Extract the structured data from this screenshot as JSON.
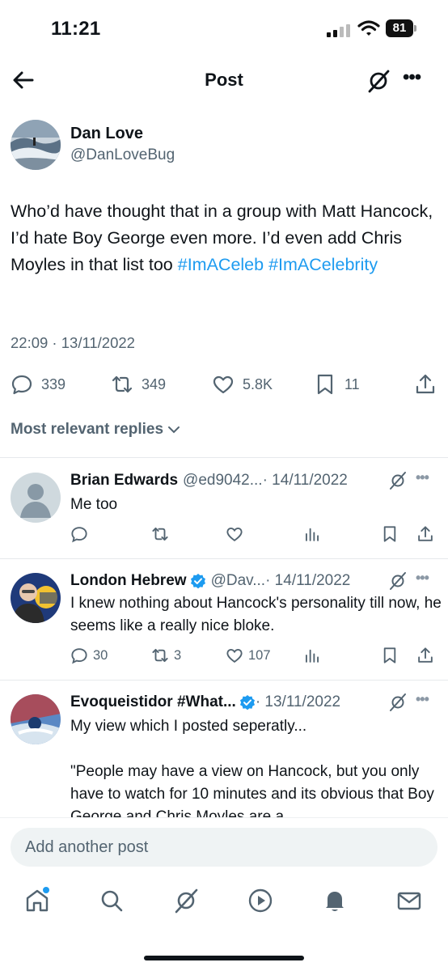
{
  "status_bar": {
    "time": "11:21",
    "battery": "81"
  },
  "header": {
    "title": "Post"
  },
  "post": {
    "author_name": "Dan Love",
    "author_handle": "@DanLoveBug",
    "text_main": "Who’d have thought that in a group with Matt Hancock, I’d hate Boy George even more. I’d even add Chris Moyles in that list too ",
    "hashtag_1": "#ImACeleb",
    "hashtag_2": "#ImACelebrity",
    "timestamp": "22:09 · 13/11/2022",
    "metrics": {
      "replies": "339",
      "reposts": "349",
      "likes": "5.8K",
      "bookmarks": "11"
    }
  },
  "replies_sort_label": "Most relevant replies",
  "replies": [
    {
      "name": "Brian Edwards",
      "handle": "@ed9042...",
      "date": "· 14/11/2022",
      "text": "Me too",
      "counts": {
        "replies": "",
        "reposts": "",
        "likes": ""
      }
    },
    {
      "name": "London Hebrew",
      "handle": "@Dav...",
      "date": "· 14/11/2022",
      "text": "I knew  nothing about Hancock's personality till now, he seems like a really nice bloke.",
      "counts": {
        "replies": "30",
        "reposts": "3",
        "likes": "107"
      }
    },
    {
      "name": "Evoqueistidor #What...",
      "handle": "",
      "date": "· 13/11/2022",
      "text_line1": "My view which I posted seperatly...",
      "text_line2": "\"People may have a view on Hancock, but you only have to watch for 10 minutes and its obvious that Boy George and Chris Moyles are a"
    }
  ],
  "composer": {
    "placeholder": "Add another post"
  },
  "colors": {
    "accent": "#1d9bf0",
    "secondary_text": "#536471",
    "divider": "#e6e9ec"
  },
  "icons": {
    "back": "arrow-left-icon",
    "grok": "grok-icon",
    "more": "more-horizontal-icon",
    "reply": "reply-icon",
    "repost": "repost-icon",
    "like": "heart-icon",
    "bookmark": "bookmark-icon",
    "share": "share-icon",
    "views": "views-icon",
    "verified": "verified-badge-icon",
    "tabs": [
      "home-icon",
      "search-icon",
      "grok-icon",
      "video-icon",
      "bell-icon",
      "mail-icon"
    ]
  }
}
